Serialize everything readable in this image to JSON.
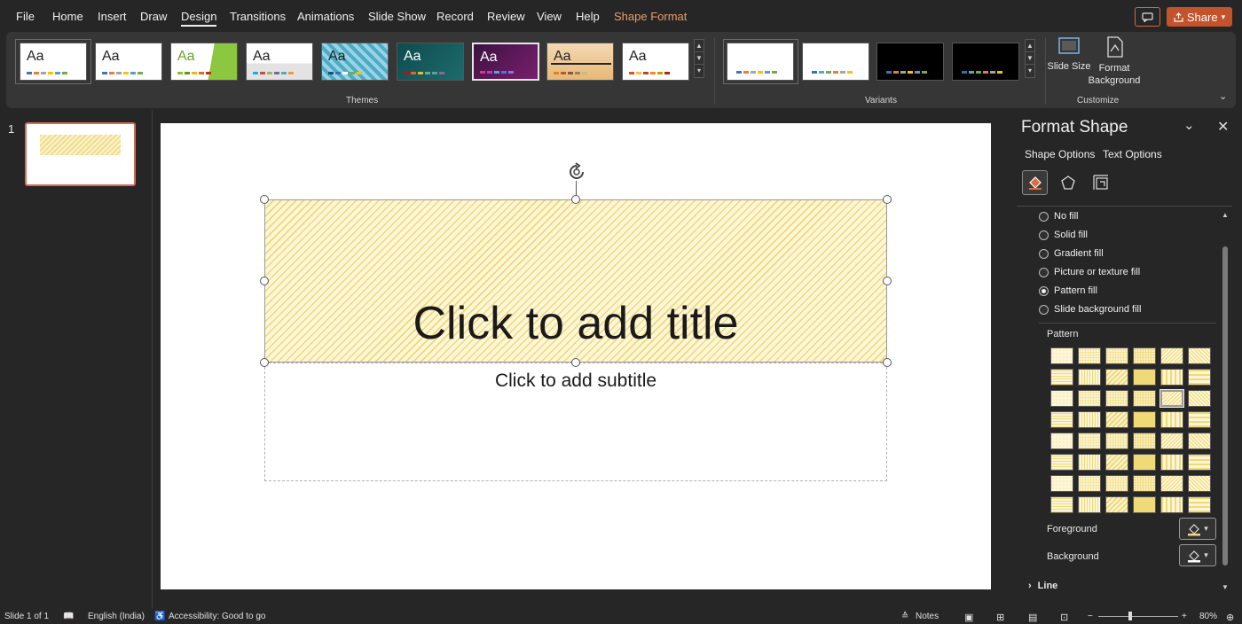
{
  "menu": {
    "file": "File",
    "home": "Home",
    "insert": "Insert",
    "draw": "Draw",
    "design": "Design",
    "transitions": "Transitions",
    "animations": "Animations",
    "slideshow": "Slide Show",
    "record": "Record",
    "review": "Review",
    "view": "View",
    "help": "Help",
    "shape_format": "Shape Format",
    "share": "Share"
  },
  "ribbon": {
    "themes_label": "Themes",
    "variants_label": "Variants",
    "customize_label": "Customize",
    "theme_sample": "Aa",
    "slide_size": "Slide Size",
    "format_background": "Format Background"
  },
  "thumbnail": {
    "number": "1"
  },
  "slide": {
    "title_placeholder": "Click to add title",
    "subtitle_placeholder": "Click to add subtitle"
  },
  "pane": {
    "title": "Format Shape",
    "tab_shape": "Shape Options",
    "tab_text": "Text Options",
    "fills": [
      {
        "label": "No fill",
        "selected": false
      },
      {
        "label": "Solid fill",
        "selected": false
      },
      {
        "label": "Gradient fill",
        "selected": false
      },
      {
        "label": "Picture or texture fill",
        "selected": false
      },
      {
        "label": "Pattern fill",
        "selected": true
      },
      {
        "label": "Slide background fill",
        "selected": false
      }
    ],
    "pattern_label": "Pattern",
    "foreground_label": "Foreground",
    "background_label": "Background",
    "line_label": "Line"
  },
  "status": {
    "slide": "Slide 1 of 1",
    "language": "English (India)",
    "accessibility": "Accessibility: Good to go",
    "notes": "Notes",
    "zoom": "80%"
  },
  "colors": {
    "accent": "#c4532b",
    "pattern_fg": "#f0d977",
    "pattern_bg": "#fdf6d8"
  }
}
